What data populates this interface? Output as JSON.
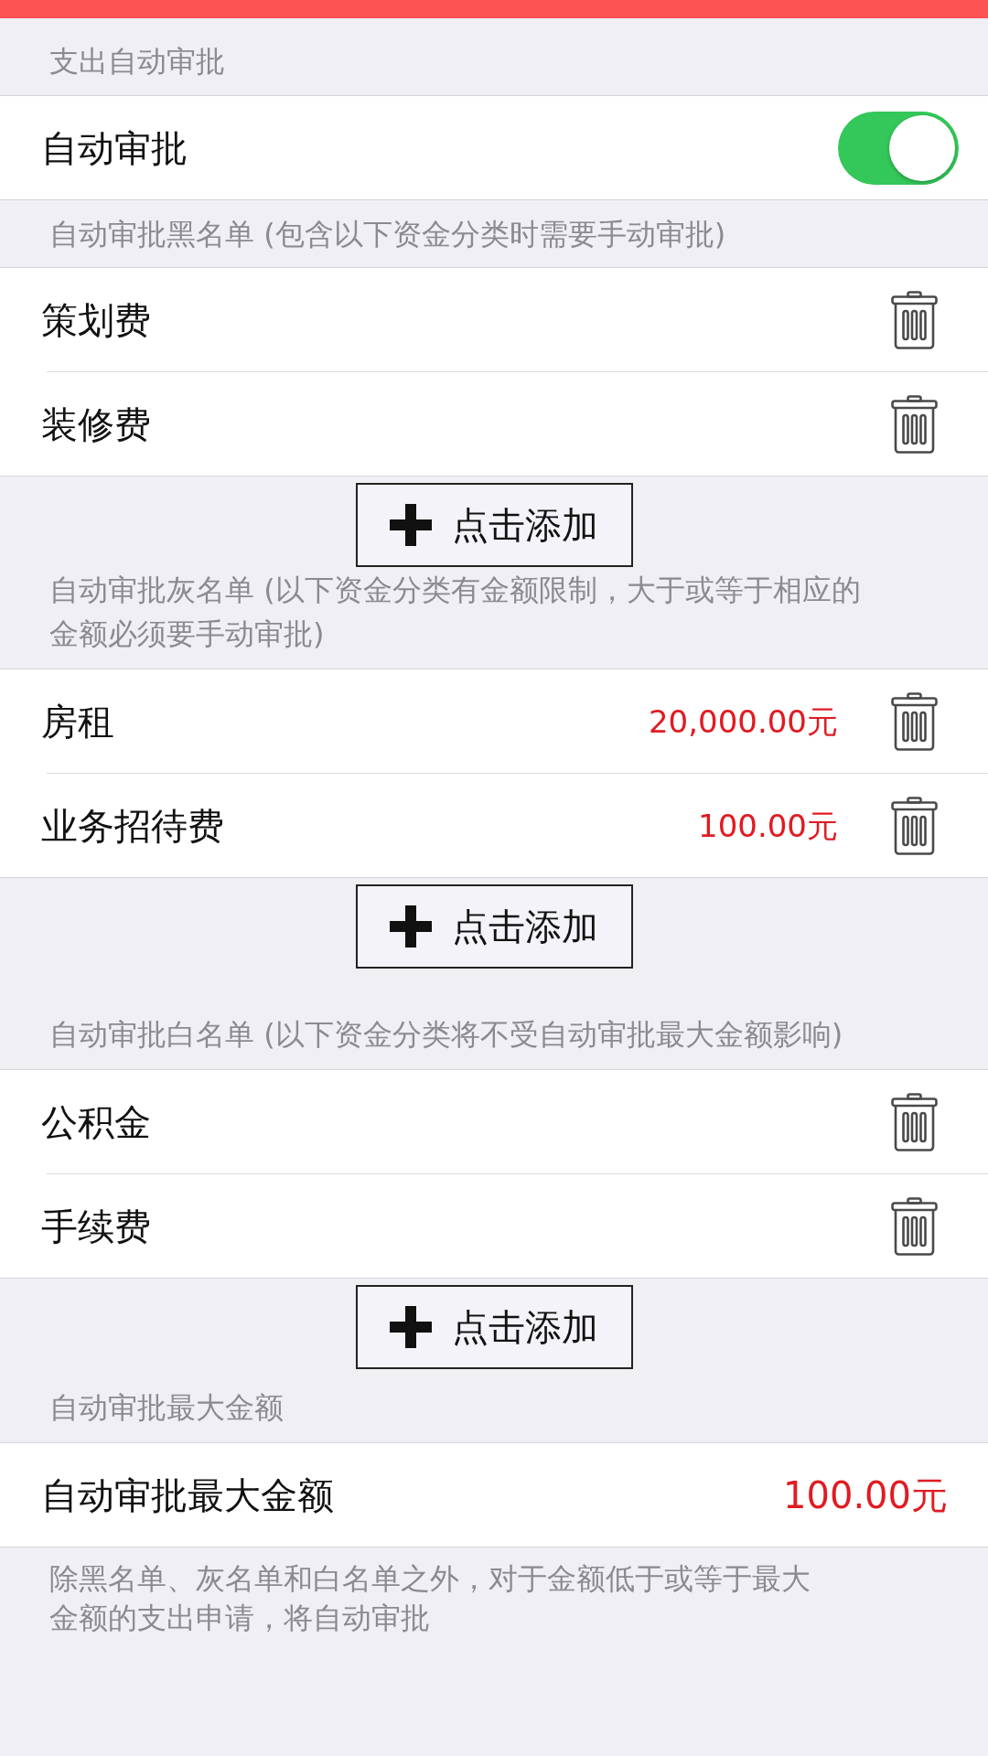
{
  "sections": [
    {
      "header": "支出自动审批",
      "rows": [
        {
          "kind": "toggle",
          "label": "自动审批",
          "on": true
        }
      ]
    },
    {
      "header": "自动审批黑名单 (包含以下资金分类时需要手动审批)",
      "rows": [
        {
          "kind": "category",
          "label": "策划费"
        },
        {
          "kind": "category",
          "label": "装修费"
        }
      ],
      "add_button": "点击添加"
    },
    {
      "header": "自动审批灰名单 (以下资金分类有金额限制，大于或等于相应的金额必须要手动审批)",
      "rows": [
        {
          "kind": "category",
          "label": "房租",
          "amount": "20,000.00元"
        },
        {
          "kind": "category",
          "label": "业务招待费",
          "amount": "100.00元"
        }
      ],
      "add_button": "点击添加"
    },
    {
      "header": "自动审批白名单 (以下资金分类将不受自动审批最大金额影响)",
      "rows": [
        {
          "kind": "category",
          "label": "公积金"
        },
        {
          "kind": "category",
          "label": "手续费"
        }
      ],
      "add_button": "点击添加"
    },
    {
      "header": "自动审批最大金额",
      "rows": [
        {
          "kind": "value",
          "label": "自动审批最大金额",
          "value": "100.00元"
        }
      ],
      "footer": "除黑名单、灰名单和白名单之外，对于金额低于或等于最大金额的支出申请，将自动审批"
    }
  ]
}
